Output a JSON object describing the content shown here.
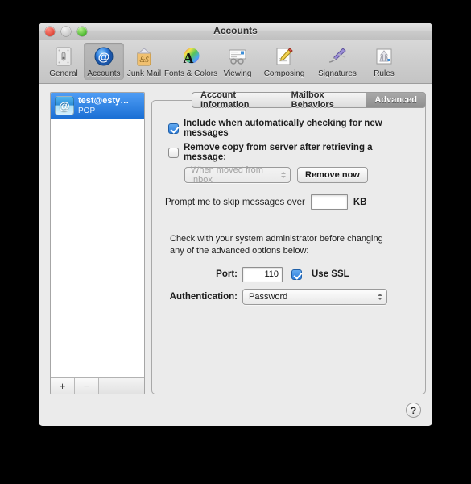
{
  "window": {
    "title": "Accounts"
  },
  "traffic": {
    "close": "close-button",
    "minimize": "minimize-button",
    "zoom": "zoom-button"
  },
  "toolbar": {
    "items": [
      {
        "label": "General",
        "icon": "general-icon"
      },
      {
        "label": "Accounts",
        "icon": "accounts-icon"
      },
      {
        "label": "Junk Mail",
        "icon": "junk-mail-icon"
      },
      {
        "label": "Fonts & Colors",
        "icon": "fonts-colors-icon"
      },
      {
        "label": "Viewing",
        "icon": "viewing-icon"
      },
      {
        "label": "Composing",
        "icon": "composing-icon"
      },
      {
        "label": "Signatures",
        "icon": "signatures-icon"
      },
      {
        "label": "Rules",
        "icon": "rules-icon"
      }
    ],
    "selected": "Accounts"
  },
  "accounts": {
    "list": [
      {
        "name": "test@esty…",
        "type": "POP",
        "icon": "at-sign-icon",
        "selected": true
      }
    ],
    "add_label": "+",
    "remove_label": "−"
  },
  "tabs": [
    {
      "label": "Account Information",
      "active": false
    },
    {
      "label": "Mailbox Behaviors",
      "active": false
    },
    {
      "label": "Advanced",
      "active": true
    }
  ],
  "advanced": {
    "include_check": {
      "label": "Include when automatically checking for new messages",
      "checked": true
    },
    "remove_copy_check": {
      "label": "Remove copy from server after retrieving a message:",
      "checked": false
    },
    "remove_when_popup": {
      "value": "When moved from Inbox",
      "disabled": true
    },
    "remove_now_button": "Remove now",
    "prompt_label": "Prompt me to skip messages over",
    "prompt_value": "",
    "prompt_unit": "KB",
    "admin_note_line1": "Check with your system administrator before changing",
    "admin_note_line2": "any of the advanced options below:",
    "port_label": "Port:",
    "port_value": "110",
    "ssl_check": {
      "label": "Use SSL",
      "checked": true
    },
    "auth_label": "Authentication:",
    "auth_value": "Password"
  },
  "help_button": "?",
  "colors": {
    "accent": "#2c7ddb",
    "selection": "#1a6fd4",
    "window_bg": "#ebebeb"
  }
}
